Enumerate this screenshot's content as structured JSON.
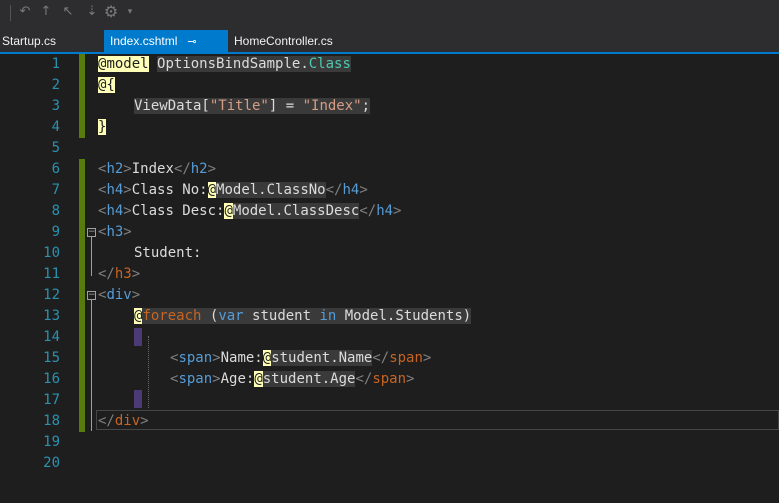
{
  "tabs": [
    {
      "label": "Startup.cs",
      "active": false
    },
    {
      "label": "Index.cshtml",
      "active": true,
      "pin": "⊸"
    },
    {
      "label": "HomeController.cs",
      "active": false
    }
  ],
  "line_numbers": [
    "1",
    "2",
    "3",
    "4",
    "5",
    "6",
    "7",
    "8",
    "9",
    "10",
    "11",
    "12",
    "13",
    "14",
    "15",
    "16",
    "17",
    "18",
    "19",
    "20"
  ],
  "code": {
    "l1_at": "@",
    "l1_model": "model",
    "l1_ns": "OptionsBindSample.",
    "l1_class": "Class",
    "l2": "@{",
    "l3_a": "ViewData[",
    "l3_str": "\"Title\"",
    "l3_b": "] = ",
    "l3_str2": "\"Index\"",
    "l3_c": ";",
    "l4": "}",
    "l6_open": "<",
    "l6_tag": "h2",
    "l6_text": "Index",
    "l7_text": "Class No:",
    "l7_expr": "Model.ClassNo",
    "l8_text": "Class Desc:",
    "l8_expr": "Model.ClassDesc",
    "l10_text": "Student:",
    "l13_foreach": "foreach",
    "l13_paren": " (",
    "l13_var": "var",
    "l13_student": " student ",
    "l13_in": "in",
    "l13_rest": " Model.Students)",
    "l15_text": "Name:",
    "l15_expr": "student.Name",
    "l16_text": "Age:",
    "l16_expr": "student.Age",
    "tag_h2": "h2",
    "tag_h4": "h4",
    "tag_h3": "h3",
    "tag_div": "div",
    "tag_span": "span"
  },
  "colors": {
    "accent": "#007acc",
    "line_number": "#2b91af",
    "changed_marker": "#587c0c",
    "tag_name": "#569cd6",
    "string": "#d69d85",
    "razor_keyword": "#c86422"
  },
  "icons": [
    "toolbar-undo-icon",
    "toolbar-redo-icon",
    "toolbar-cursor-icon",
    "toolbar-bulb-icon",
    "toolbar-gear-icon",
    "toolbar-dropdown-icon"
  ]
}
